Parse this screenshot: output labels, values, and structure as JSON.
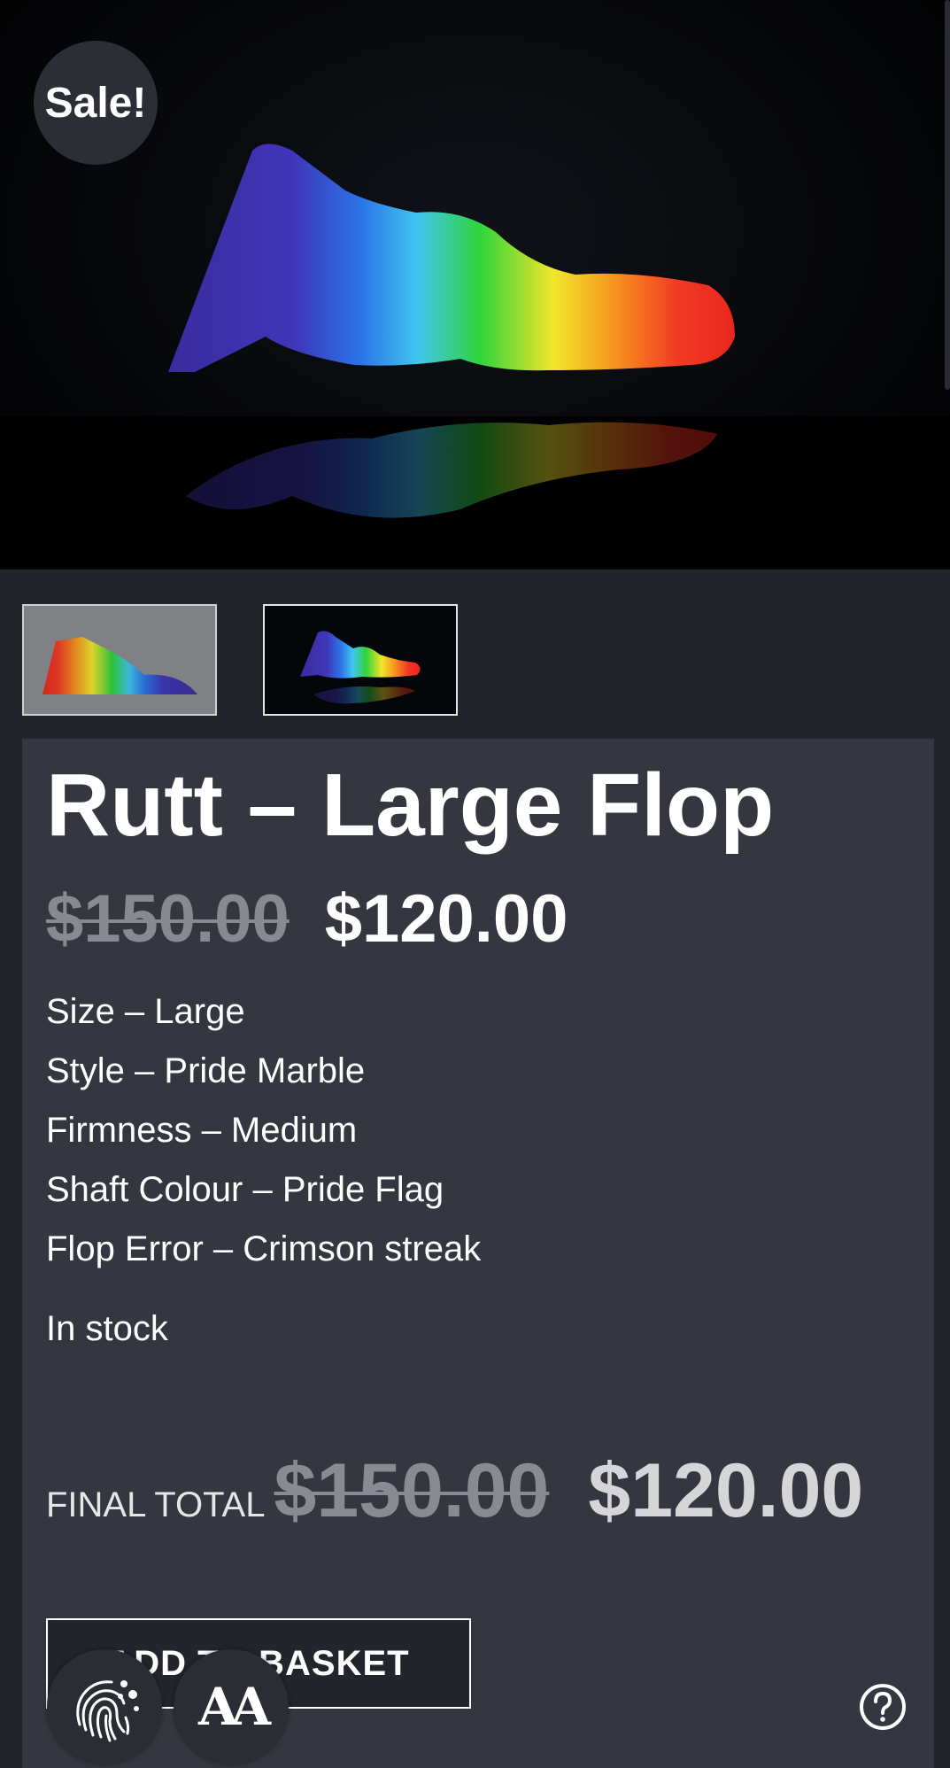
{
  "badge": {
    "sale": "Sale!"
  },
  "product": {
    "title": "Rutt – Large Flop",
    "regular_price": "$150.00",
    "sale_price": "$120.00",
    "attributes": [
      "Size – Large",
      "Style – Pride Marble",
      "Firmness – Medium",
      "Shaft Colour – Pride Flag",
      "Flop Error – Crimson streak"
    ],
    "stock_status": "In stock"
  },
  "total": {
    "label": "FINAL TOTAL",
    "old_price": "$150.00",
    "new_price": "$120.00"
  },
  "actions": {
    "add_to_basket": "ADD TO BASKET"
  },
  "icons": {
    "cookie": "fingerprint-cookie-icon",
    "text_size": "text-size-icon",
    "help": "help-icon"
  },
  "colors": {
    "page_bg": "#23252c",
    "panel_bg": "#353740",
    "badge_bg": "#2c2e36",
    "strike_price": "#888a90"
  }
}
